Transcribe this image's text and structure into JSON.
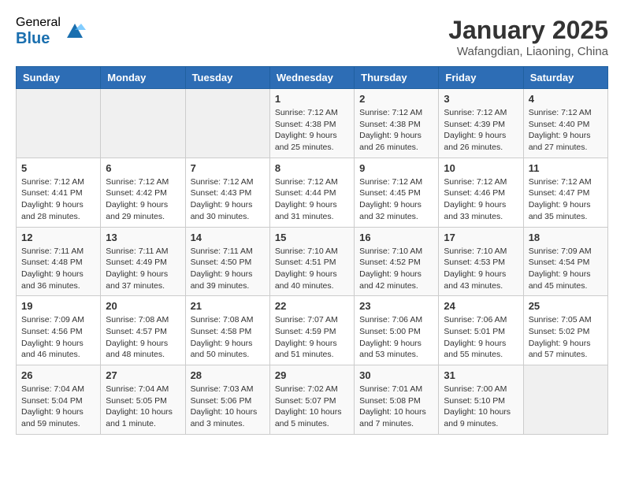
{
  "header": {
    "logo_general": "General",
    "logo_blue": "Blue",
    "month_title": "January 2025",
    "location": "Wafangdian, Liaoning, China"
  },
  "days_of_week": [
    "Sunday",
    "Monday",
    "Tuesday",
    "Wednesday",
    "Thursday",
    "Friday",
    "Saturday"
  ],
  "weeks": [
    [
      {
        "day": "",
        "info": ""
      },
      {
        "day": "",
        "info": ""
      },
      {
        "day": "",
        "info": ""
      },
      {
        "day": "1",
        "info": "Sunrise: 7:12 AM\nSunset: 4:38 PM\nDaylight: 9 hours and 25 minutes."
      },
      {
        "day": "2",
        "info": "Sunrise: 7:12 AM\nSunset: 4:38 PM\nDaylight: 9 hours and 26 minutes."
      },
      {
        "day": "3",
        "info": "Sunrise: 7:12 AM\nSunset: 4:39 PM\nDaylight: 9 hours and 26 minutes."
      },
      {
        "day": "4",
        "info": "Sunrise: 7:12 AM\nSunset: 4:40 PM\nDaylight: 9 hours and 27 minutes."
      }
    ],
    [
      {
        "day": "5",
        "info": "Sunrise: 7:12 AM\nSunset: 4:41 PM\nDaylight: 9 hours and 28 minutes."
      },
      {
        "day": "6",
        "info": "Sunrise: 7:12 AM\nSunset: 4:42 PM\nDaylight: 9 hours and 29 minutes."
      },
      {
        "day": "7",
        "info": "Sunrise: 7:12 AM\nSunset: 4:43 PM\nDaylight: 9 hours and 30 minutes."
      },
      {
        "day": "8",
        "info": "Sunrise: 7:12 AM\nSunset: 4:44 PM\nDaylight: 9 hours and 31 minutes."
      },
      {
        "day": "9",
        "info": "Sunrise: 7:12 AM\nSunset: 4:45 PM\nDaylight: 9 hours and 32 minutes."
      },
      {
        "day": "10",
        "info": "Sunrise: 7:12 AM\nSunset: 4:46 PM\nDaylight: 9 hours and 33 minutes."
      },
      {
        "day": "11",
        "info": "Sunrise: 7:12 AM\nSunset: 4:47 PM\nDaylight: 9 hours and 35 minutes."
      }
    ],
    [
      {
        "day": "12",
        "info": "Sunrise: 7:11 AM\nSunset: 4:48 PM\nDaylight: 9 hours and 36 minutes."
      },
      {
        "day": "13",
        "info": "Sunrise: 7:11 AM\nSunset: 4:49 PM\nDaylight: 9 hours and 37 minutes."
      },
      {
        "day": "14",
        "info": "Sunrise: 7:11 AM\nSunset: 4:50 PM\nDaylight: 9 hours and 39 minutes."
      },
      {
        "day": "15",
        "info": "Sunrise: 7:10 AM\nSunset: 4:51 PM\nDaylight: 9 hours and 40 minutes."
      },
      {
        "day": "16",
        "info": "Sunrise: 7:10 AM\nSunset: 4:52 PM\nDaylight: 9 hours and 42 minutes."
      },
      {
        "day": "17",
        "info": "Sunrise: 7:10 AM\nSunset: 4:53 PM\nDaylight: 9 hours and 43 minutes."
      },
      {
        "day": "18",
        "info": "Sunrise: 7:09 AM\nSunset: 4:54 PM\nDaylight: 9 hours and 45 minutes."
      }
    ],
    [
      {
        "day": "19",
        "info": "Sunrise: 7:09 AM\nSunset: 4:56 PM\nDaylight: 9 hours and 46 minutes."
      },
      {
        "day": "20",
        "info": "Sunrise: 7:08 AM\nSunset: 4:57 PM\nDaylight: 9 hours and 48 minutes."
      },
      {
        "day": "21",
        "info": "Sunrise: 7:08 AM\nSunset: 4:58 PM\nDaylight: 9 hours and 50 minutes."
      },
      {
        "day": "22",
        "info": "Sunrise: 7:07 AM\nSunset: 4:59 PM\nDaylight: 9 hours and 51 minutes."
      },
      {
        "day": "23",
        "info": "Sunrise: 7:06 AM\nSunset: 5:00 PM\nDaylight: 9 hours and 53 minutes."
      },
      {
        "day": "24",
        "info": "Sunrise: 7:06 AM\nSunset: 5:01 PM\nDaylight: 9 hours and 55 minutes."
      },
      {
        "day": "25",
        "info": "Sunrise: 7:05 AM\nSunset: 5:02 PM\nDaylight: 9 hours and 57 minutes."
      }
    ],
    [
      {
        "day": "26",
        "info": "Sunrise: 7:04 AM\nSunset: 5:04 PM\nDaylight: 9 hours and 59 minutes."
      },
      {
        "day": "27",
        "info": "Sunrise: 7:04 AM\nSunset: 5:05 PM\nDaylight: 10 hours and 1 minute."
      },
      {
        "day": "28",
        "info": "Sunrise: 7:03 AM\nSunset: 5:06 PM\nDaylight: 10 hours and 3 minutes."
      },
      {
        "day": "29",
        "info": "Sunrise: 7:02 AM\nSunset: 5:07 PM\nDaylight: 10 hours and 5 minutes."
      },
      {
        "day": "30",
        "info": "Sunrise: 7:01 AM\nSunset: 5:08 PM\nDaylight: 10 hours and 7 minutes."
      },
      {
        "day": "31",
        "info": "Sunrise: 7:00 AM\nSunset: 5:10 PM\nDaylight: 10 hours and 9 minutes."
      },
      {
        "day": "",
        "info": ""
      }
    ]
  ]
}
